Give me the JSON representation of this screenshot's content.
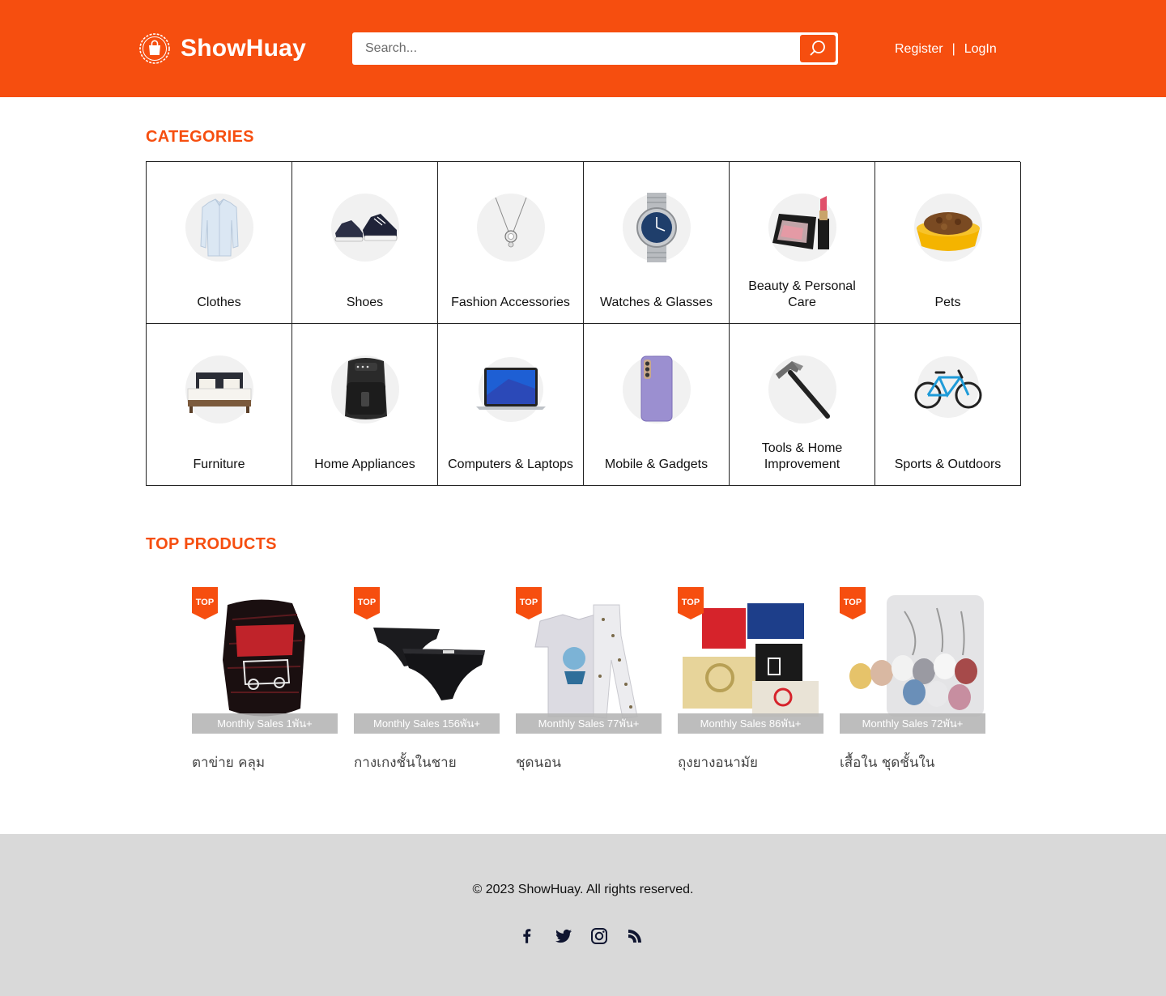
{
  "header": {
    "brand": "ShowHuay",
    "search_placeholder": "Search...",
    "register_label": "Register",
    "separator": "|",
    "login_label": "LogIn",
    "accent_color": "#f64e0f"
  },
  "categories": {
    "title": "CATEGORIES",
    "items": [
      {
        "label": "Clothes",
        "icon": "shirt-icon"
      },
      {
        "label": "Shoes",
        "icon": "sneakers-icon"
      },
      {
        "label": "Fashion Accessories",
        "icon": "necklace-icon"
      },
      {
        "label": "Watches & Glasses",
        "icon": "watch-icon"
      },
      {
        "label": "Beauty & Personal Care",
        "icon": "makeup-icon"
      },
      {
        "label": "Pets",
        "icon": "pet-bowl-icon"
      },
      {
        "label": "Furniture",
        "icon": "bed-icon"
      },
      {
        "label": "Home Appliances",
        "icon": "air-fryer-icon"
      },
      {
        "label": "Computers & Laptops",
        "icon": "laptop-icon"
      },
      {
        "label": "Mobile & Gadgets",
        "icon": "phone-icon"
      },
      {
        "label": "Tools & Home Improvement",
        "icon": "hammer-icon"
      },
      {
        "label": "Sports & Outdoors",
        "icon": "bicycle-icon"
      }
    ]
  },
  "top_products": {
    "title": "TOP PRODUCTS",
    "badge": "TOP",
    "items": [
      {
        "name": "ตาข่าย คลุม",
        "sales": "Monthly Sales 1พัน+"
      },
      {
        "name": "กางเกงชั้นในชาย",
        "sales": "Monthly Sales 156พัน+"
      },
      {
        "name": "ชุดนอน",
        "sales": "Monthly Sales 77พัน+"
      },
      {
        "name": "ถุงยางอนามัย",
        "sales": "Monthly Sales 86พัน+"
      },
      {
        "name": "เสื้อใน ชุดชั้นใน",
        "sales": "Monthly Sales 72พัน+"
      }
    ]
  },
  "footer": {
    "copyright": "© 2023 ShowHuay. All rights reserved.",
    "social": [
      "facebook-icon",
      "twitter-icon",
      "instagram-icon",
      "rss-icon"
    ]
  }
}
